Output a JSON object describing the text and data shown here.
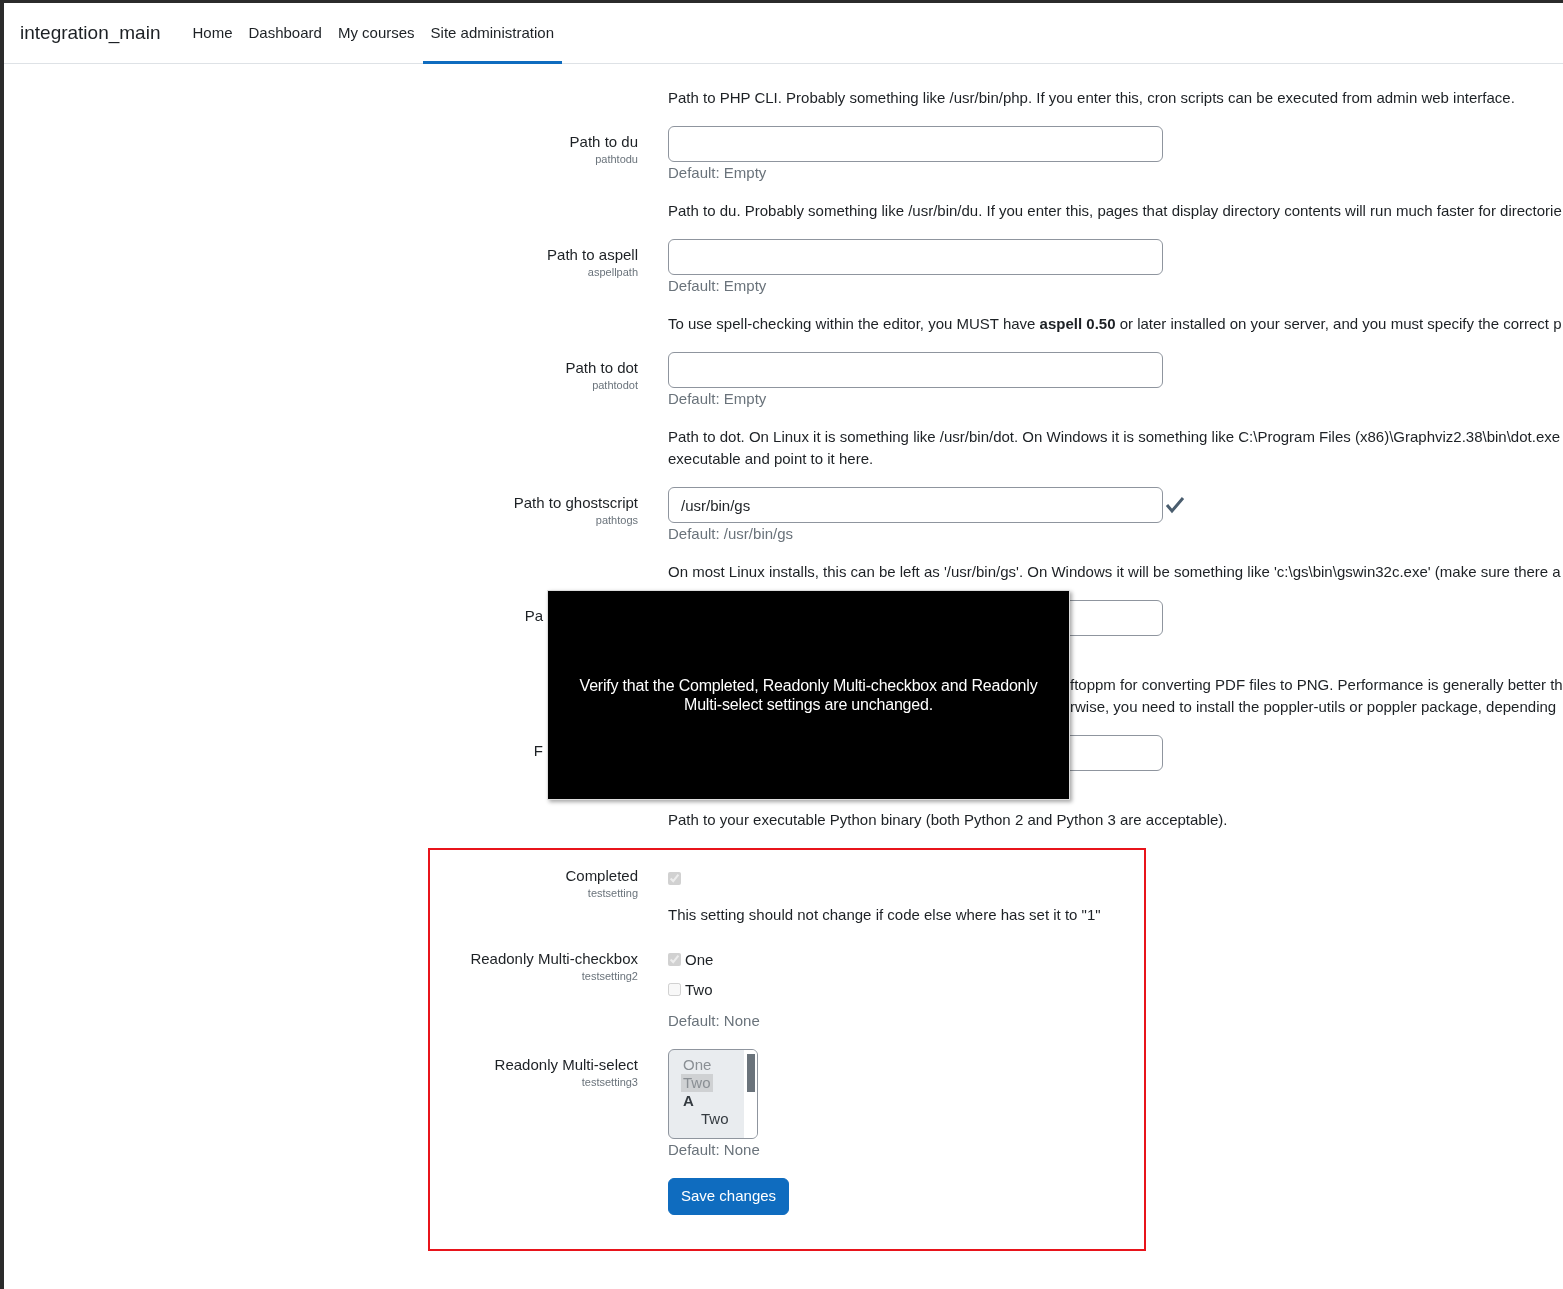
{
  "navbar": {
    "brand": "integration_main",
    "links": [
      {
        "label": "Home",
        "selected": false
      },
      {
        "label": "Dashboard",
        "selected": false
      },
      {
        "label": "My courses",
        "selected": false
      },
      {
        "label": "Site administration",
        "selected": true
      }
    ]
  },
  "intro_description": "Path to PHP CLI. Probably something like /usr/bin/php. If you enter this, cron scripts can be executed from admin web interface.",
  "settings": [
    {
      "kind": "text",
      "label": "Path to du",
      "name": "pathtodu",
      "default": "Default: Empty",
      "valid": false,
      "description": [
        "Path to du. Probably something like /usr/bin/du. If you enter this, pages that display directory contents will run much faster for directorie"
      ]
    },
    {
      "kind": "text",
      "label": "Path to aspell",
      "name": "aspellpath",
      "default": "Default: Empty",
      "valid": false,
      "description": [
        "To use spell-checking within the editor, you MUST have **aspell 0.50** or later installed on your server, and you must specify the correct p"
      ]
    },
    {
      "kind": "text",
      "label": "Path to dot",
      "name": "pathtodot",
      "default": "Default: Empty",
      "valid": false,
      "description": [
        "Path to dot. On Linux it is something like /usr/bin/dot. On Windows it is something like C:\\Program Files (x86)\\Graphviz2.38\\bin\\dot.exe",
        "executable and point to it here."
      ]
    },
    {
      "kind": "text",
      "label": "Path to ghostscript",
      "name": "pathtogs",
      "value": "/usr/bin/gs",
      "default": "Default: /usr/bin/gs",
      "valid": true,
      "description": [
        "On most Linux installs, this can be left as '/usr/bin/gs'. On Windows it will be something like 'c:\\gs\\bin\\gswin32c.exe' (make sure there a"
      ]
    },
    {
      "kind": "covered",
      "label": "Pa",
      "description": [
        "ftoppm for converting PDF files to PNG. Performance is generally better th",
        "rwise, you need to install the poppler-utils or poppler package, depending"
      ]
    },
    {
      "kind": "covered_label",
      "label": "F",
      "description": [
        "Path to your executable Python binary (both Python 2 and Python 3 are acceptable)."
      ]
    }
  ],
  "overlay": {
    "message": "Verify that the Completed, Readonly Multi-checkbox and Readonly Multi-select settings are unchanged."
  },
  "test_section": {
    "settings": [
      {
        "kind": "checkbox",
        "label": "Completed",
        "name": "testsetting",
        "checked": true,
        "disabled": true,
        "description": "This setting should not change if code else where has set it to \"1\""
      },
      {
        "kind": "multicheckbox",
        "label": "Readonly Multi-checkbox",
        "name": "testsetting2",
        "options": [
          {
            "label": "One",
            "checked": true,
            "disabled": true
          },
          {
            "label": "Two",
            "checked": false,
            "disabled": true
          }
        ],
        "default": "Default: None"
      },
      {
        "kind": "multiselect",
        "label": "Readonly Multi-select",
        "name": "testsetting3",
        "options": [
          {
            "kind": "option",
            "label": "One",
            "selected": false
          },
          {
            "kind": "option",
            "label": "Two",
            "selected": true
          },
          {
            "kind": "group",
            "label": "A"
          },
          {
            "kind": "suboption",
            "label": "Two",
            "selected": false
          }
        ],
        "default": "Default: None"
      }
    ],
    "save_button": "Save changes"
  }
}
